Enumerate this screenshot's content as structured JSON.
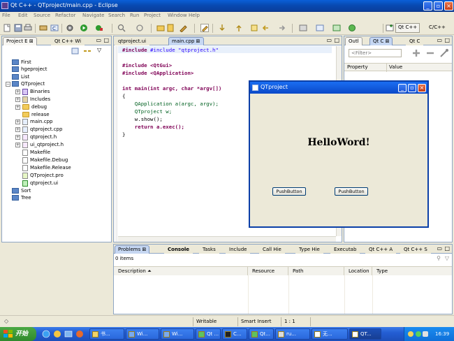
{
  "window": {
    "title": "Qt C++ - QTproject/main.cpp - Eclipse"
  },
  "menu": [
    "File",
    "Edit",
    "Source",
    "Refactor",
    "Navigate",
    "Search",
    "Run",
    "Project",
    "Window",
    "Help"
  ],
  "perspectives": [
    "Qt C++",
    "C/C++"
  ],
  "project_explorer": {
    "tabs": [
      "Project E",
      "Qt C++ Wi"
    ],
    "projects": [
      {
        "name": "First"
      },
      {
        "name": "hgeproject"
      },
      {
        "name": "List"
      },
      {
        "name": "QTproject"
      }
    ],
    "qtproject_children": [
      {
        "name": "Binaries"
      },
      {
        "name": "Includes"
      },
      {
        "name": "debug"
      },
      {
        "name": "release"
      },
      {
        "name": "main.cpp"
      },
      {
        "name": "qtproject.cpp"
      },
      {
        "name": "qtproject.h"
      },
      {
        "name": "ui_qtproject.h"
      },
      {
        "name": "Makefile"
      },
      {
        "name": "Makefile.Debug"
      },
      {
        "name": "Makefile.Release"
      },
      {
        "name": "QTproject.pro"
      },
      {
        "name": "qtproject.ui"
      }
    ],
    "more_projects": [
      {
        "name": "Sort"
      },
      {
        "name": "Tree"
      }
    ]
  },
  "editor": {
    "tabs": [
      "qtproject.ui",
      "main.cpp"
    ],
    "code": {
      "line1": "#include \"qtproject.h\"",
      "line3": "#include <QtGui>",
      "line4": "#include <QApplication>",
      "line6": "int main(int argc, char *argv[])",
      "line7": "{",
      "line8": "    QApplication a(argc, argv);",
      "line9": "    QTproject w;",
      "line10": "    w.show();",
      "line11": "    return a.exec();",
      "line12": "}"
    }
  },
  "right_panel": {
    "tabs": [
      "Outl",
      "Qt C",
      "Qt C"
    ],
    "filter_placeholder": "<Filter>",
    "columns": [
      "Property",
      "Value"
    ]
  },
  "qt_dialog": {
    "title": "QTproject",
    "label": "HelloWord!",
    "buttons": [
      "PushButton",
      "PushButton"
    ]
  },
  "bottom_panel": {
    "tabs": [
      "Problems",
      "Console",
      "Tasks",
      "Include",
      "Call Hie",
      "Type Hie",
      "Executab",
      "Qt C++ A",
      "Qt C++ S"
    ],
    "count": "0 items",
    "columns": [
      "Description",
      "Resource",
      "Path",
      "Location",
      "Type"
    ]
  },
  "status": {
    "mode": "Writable",
    "insert": "Smart Insert",
    "position": "1 : 1"
  },
  "taskbar": {
    "start": "开始",
    "tasks": [
      "书...",
      "Wi...",
      "Wi...",
      "Qt ...",
      "C...",
      "Qt...",
      "ru...",
      "无...",
      "QT..."
    ],
    "clock": "16:39"
  }
}
